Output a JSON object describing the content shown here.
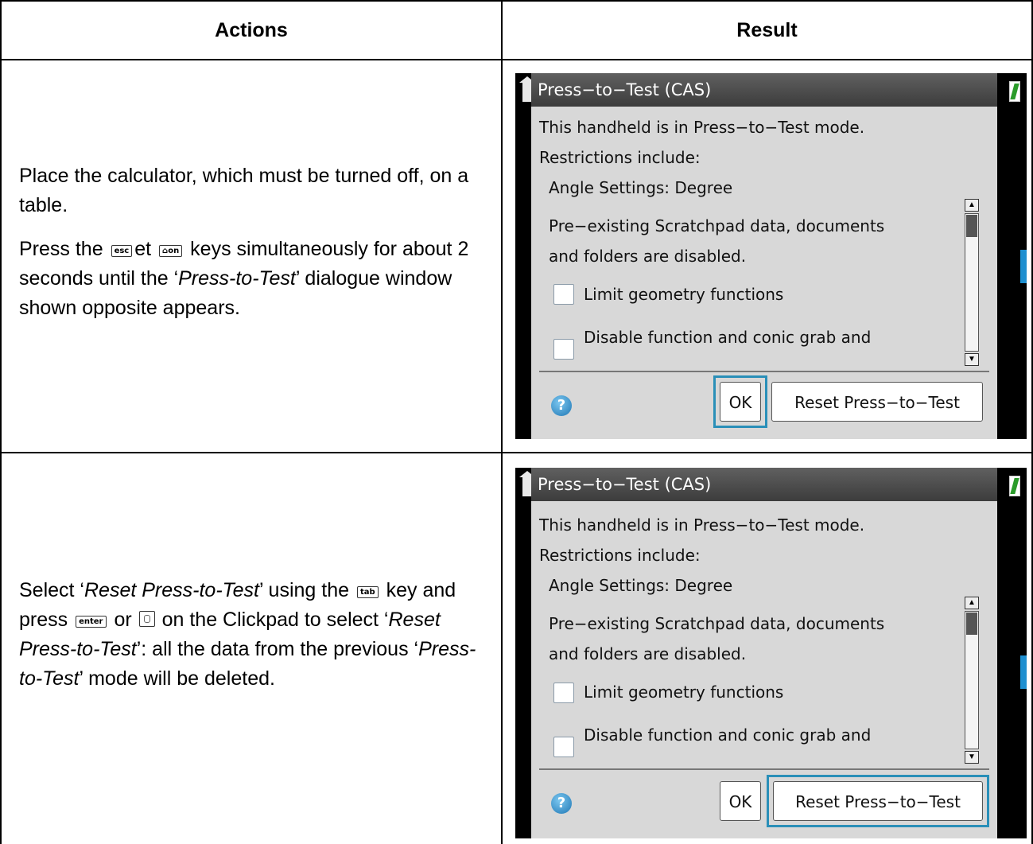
{
  "table": {
    "headers": [
      "Actions",
      "Result"
    ]
  },
  "rows": [
    {
      "action": {
        "p1": "Place the calculator, which must be turned off, on a table.",
        "p2_a": "Press the",
        "p2_key1": "esc",
        "p2_b": "et",
        "p2_key2": "on",
        "p2_c": "keys simultaneously for about 2 seconds until the ‘",
        "p2_em": "Press-to-Test",
        "p2_d": "’ dialogue window shown opposite appears."
      }
    },
    {
      "action": {
        "a": "Select ‘",
        "em1": "Reset Press-to-Test",
        "b": "’ using the",
        "key1": "tab",
        "c": "key and press",
        "key2": "enter",
        "d": "or",
        "e": "on the Clickpad to select ‘",
        "em2": "Reset Press-to-Test",
        "f": "’: all the data from the previous ‘",
        "em3": "Press-to-Test",
        "g": "’ mode will be deleted."
      }
    }
  ],
  "dialog": {
    "title": "Press−to−Test (CAS)",
    "line1": "This handheld is in Press−to−Test mode.",
    "line2": "Restrictions include:",
    "line3": "Angle Settings: Degree",
    "line4": "Pre−existing Scratchpad data, documents",
    "line5": "and folders are disabled.",
    "option1": "Limit geometry functions",
    "option2": "Disable function and conic grab and",
    "help": "?",
    "ok": "OK",
    "reset": "Reset Press−to−Test"
  },
  "colors": {
    "focus": "#2a8fb8",
    "title_bar": "#4a4a4a",
    "dialog_bg": "#d8d8d8"
  },
  "focus_state": [
    "ok-button",
    "reset-button"
  ]
}
